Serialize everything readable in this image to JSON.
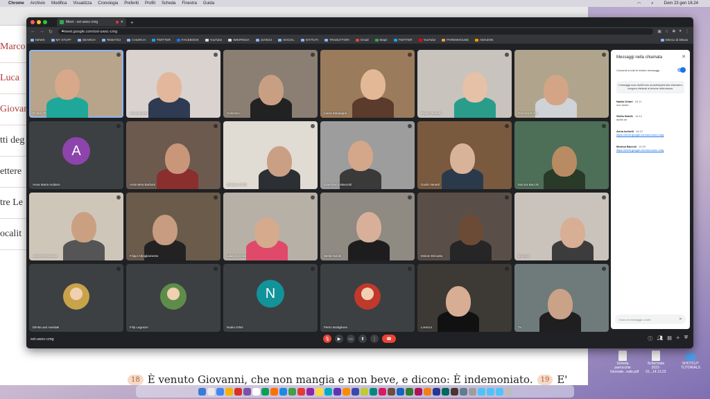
{
  "menubar": {
    "app": "Chrome",
    "items": [
      "Archivio",
      "Modifica",
      "Visualizza",
      "Cronologia",
      "Preferiti",
      "Profili",
      "Scheda",
      "Finestra",
      "Guida"
    ],
    "clock": "Dom 23 gen 16:24"
  },
  "doc": {
    "left_lines": [
      "Marco",
      "Luca",
      "Giovan",
      "tti deg",
      "ettere",
      "tre Le",
      "ocalit"
    ],
    "verse_a": "18",
    "verse_text": "È venuto Giovanni, che non mangia e non beve, e dicono: È indemoniato.",
    "verse_b": "19",
    "verse_tail": "E'"
  },
  "desktop_icons": [
    {
      "label": "Scheda parrocchie Giornate...nale.pdf"
    },
    {
      "label": "Schermata 2022-01...14.13.23"
    },
    {
      "label": "SHOTCUT TUTORIALS"
    }
  ],
  "browser": {
    "tab_title": "Meet - sxt-uwxc-cmg",
    "url": "meet.google.com/sxt-uwxc-cmg",
    "bookmarks": [
      "NEWS",
      "MY STUFF",
      "SEARCH",
      "TEMATICI",
      "CHURCH",
      "TWITTER",
      "FACEBOOK",
      "YouTube",
      "WIKIPEDIA",
      "JUVE24",
      "SOCIAL",
      "ISTITUTI",
      "TRADUTTORI",
      "Gmail",
      "Maps",
      "TWITTER",
      "YouTube",
      "PHRENHOUSE",
      "AMAZON"
    ],
    "reading_list": "Elenco di lettura"
  },
  "participants": [
    {
      "name": "Chiara (Ti",
      "kind": "video",
      "bg": "#b7a48a",
      "skin": "#d8a88a",
      "shirt": "#1fa89a",
      "active": true
    },
    {
      "name": "Anna lacheiti",
      "kind": "video",
      "bg": "#d9d2ce",
      "skin": "#e2b79b",
      "shirt": "#2f3b52"
    },
    {
      "name": "Celestino...",
      "kind": "video",
      "bg": "#8a7f72",
      "skin": "#c99f84",
      "shirt": "#222"
    },
    {
      "name": "Laura Zanaugna",
      "kind": "video",
      "bg": "#9a7b5c",
      "skin": "#e3b896",
      "shirt": "#5b3b2c"
    },
    {
      "name": "Paola Chiarelli",
      "kind": "video",
      "bg": "#c8c3bd",
      "skin": "#e6c0a7",
      "shirt": "#2a9d8a"
    },
    {
      "name": "Gemma Sorra",
      "kind": "video",
      "bg": "#b0a58c",
      "skin": "#d3a586",
      "shirt": "#cfd2d6"
    },
    {
      "name": "Anna Maria Andario",
      "kind": "avatar",
      "letter": "A",
      "color": "#8e44ad"
    },
    {
      "name": "Antonietta Barbani",
      "kind": "video",
      "bg": "#6c5a4f",
      "skin": "#c9967a",
      "shirt": "#8b2e2e"
    },
    {
      "name": "Giuliano Cicini",
      "kind": "video",
      "bg": "#e0dbd3",
      "skin": "#c9a083",
      "shirt": "#2c2f33"
    },
    {
      "name": "Gianfranco Mascotti",
      "kind": "video",
      "bg": "#9d9d9d",
      "skin": "#d4a68a",
      "shirt": "#3a3a3a"
    },
    {
      "name": "Guido Vanetti",
      "kind": "video",
      "bg": "#7a5a3e",
      "skin": "#d9b29a",
      "shirt": "#2b3a4a"
    },
    {
      "name": "Monica Baccini",
      "kind": "video",
      "bg": "#4d6e57",
      "skin": "#b98b63",
      "shirt": "#2a3a28"
    },
    {
      "name": "Carla Pezzarossa",
      "kind": "video",
      "bg": "#cfc6ba",
      "skin": "#caa080",
      "shirt": "#555"
    },
    {
      "name": "Filippi Abbigliamento",
      "kind": "video",
      "bg": "#6b5b4b",
      "skin": "#c79c80",
      "shirt": "#222"
    },
    {
      "name": "Lalia Dorizzila",
      "kind": "video",
      "bg": "#b7b0a7",
      "skin": "#d6aa8c",
      "shirt": "#e04a6a"
    },
    {
      "name": "Stella Nobile",
      "kind": "video",
      "bg": "#8f8a82",
      "skin": "#d8b09a",
      "shirt": "#1d1d1d"
    },
    {
      "name": "Miriam Brizuela",
      "kind": "video",
      "bg": "#5a4f48",
      "skin": "#6b4b36",
      "shirt": "#262626"
    },
    {
      "name": "lina rizzi",
      "kind": "video",
      "bg": "#c9c3bb",
      "skin": "#d8ae94",
      "shirt": "#3c3c3c"
    },
    {
      "name": "Diletta asti maridati",
      "kind": "photo",
      "color": "#c8a34a"
    },
    {
      "name": "Filip Lagrazie",
      "kind": "photo",
      "color": "#5e8d4a"
    },
    {
      "name": "Nadia Orlini",
      "kind": "avatar",
      "letter": "N",
      "color": "#12939a"
    },
    {
      "name": "Pietro Buttiglione",
      "kind": "photo",
      "color": "#c0392b"
    },
    {
      "name": "Lorenzo",
      "kind": "video",
      "bg": "#3d3a36",
      "skin": "#d7ae93",
      "shirt": "#111"
    },
    {
      "name": "Tu",
      "kind": "video",
      "bg": "#6e7b7a",
      "skin": "#caa287",
      "shirt": "#1f1f1f"
    }
  ],
  "meet": {
    "code": "sxt-uwxc-cmg"
  },
  "chat": {
    "title": "Messaggi nella chiamata",
    "allow_label": "Consenti a tutti di inviare messaggi",
    "note": "I messaggi sono visibili solo ai partecipanti alla chiamata e vengono eliminati al termine della stessa.",
    "messages": [
      {
        "who": "Nadia Orlani",
        "time": "16:11",
        "text": "non sento"
      },
      {
        "who": "Stella Nobile",
        "time": "16:12",
        "text": "audio ok"
      },
      {
        "who": "Anna lacheiti",
        "time": "16:22",
        "text": "https://meet.google.com/sxt-uwxc-cmg"
      },
      {
        "who": "Monica Baccini",
        "time": "16:23",
        "text": "https://meet.google.com/sxt-uwxc-cmg"
      }
    ],
    "input_placeholder": "Invia un messaggio a tutti"
  }
}
